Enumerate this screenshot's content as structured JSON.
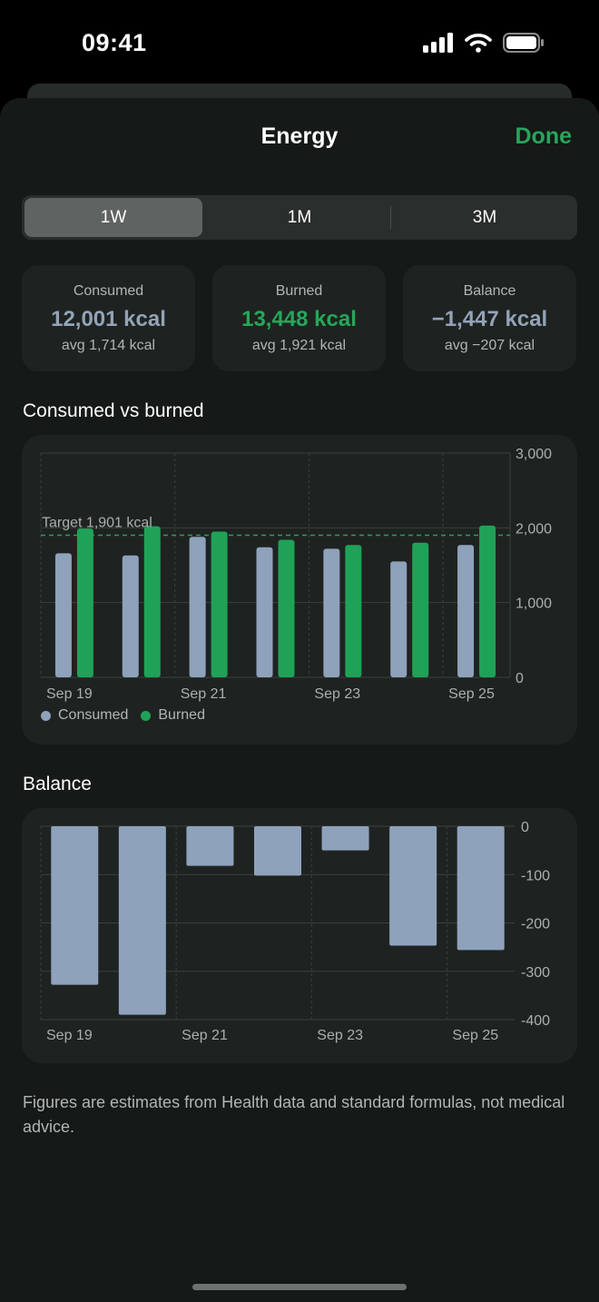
{
  "status_bar": {
    "time": "09:41",
    "icons": [
      "cellular-signal-icon",
      "wifi-icon",
      "battery-icon"
    ]
  },
  "header": {
    "title": "Energy",
    "done_label": "Done"
  },
  "segments": {
    "items": [
      "1W",
      "1M",
      "3M"
    ],
    "selected": "1W"
  },
  "stats": {
    "consumed": {
      "label": "Consumed",
      "value": "12,001 kcal",
      "avg": "avg 1,714 kcal"
    },
    "burned": {
      "label": "Burned",
      "value": "13,448 kcal",
      "avg": "avg 1,921 kcal"
    },
    "balance": {
      "label": "Balance",
      "value": "−1,447 kcal",
      "avg": "avg −207 kcal"
    }
  },
  "sections": {
    "consumed_vs_burned": "Consumed vs burned",
    "balance": "Balance"
  },
  "legend": {
    "consumed": "Consumed",
    "burned": "Burned"
  },
  "colors": {
    "consumed": "#8fa2bb",
    "burned": "#1fa257",
    "accent": "#2aa45c",
    "target_line": "#2a9d58"
  },
  "chart_data": [
    {
      "type": "bar",
      "title": "Consumed vs burned",
      "categories": [
        "Sep 19",
        "Sep 20",
        "Sep 21",
        "Sep 22",
        "Sep 23",
        "Sep 24",
        "Sep 25"
      ],
      "x_tick_labels": [
        "Sep 19",
        "Sep 21",
        "Sep 23",
        "Sep 25"
      ],
      "series": [
        {
          "name": "Consumed",
          "values": [
            1660,
            1630,
            1880,
            1740,
            1720,
            1550,
            1770
          ]
        },
        {
          "name": "Burned",
          "values": [
            1990,
            2020,
            1950,
            1840,
            1770,
            1800,
            2030
          ]
        }
      ],
      "target": {
        "label": "Target 1,901 kcal",
        "value": 1901
      },
      "ylim": [
        0,
        3000
      ],
      "y_ticks": [
        0,
        1000,
        2000,
        3000
      ],
      "y_tick_labels": [
        "0",
        "1,000",
        "2,000",
        "3,000"
      ],
      "legend": "bottom-left",
      "grid": true
    },
    {
      "type": "bar",
      "title": "Balance",
      "categories": [
        "Sep 19",
        "Sep 20",
        "Sep 21",
        "Sep 22",
        "Sep 23",
        "Sep 24",
        "Sep 25"
      ],
      "x_tick_labels": [
        "Sep 19",
        "Sep 21",
        "Sep 23",
        "Sep 25"
      ],
      "values": [
        -328,
        -390,
        -82,
        -102,
        -50,
        -247,
        -256
      ],
      "ylim": [
        -400,
        0
      ],
      "y_ticks": [
        0,
        -100,
        -200,
        -300,
        -400
      ],
      "y_tick_labels": [
        "0",
        "-100",
        "-200",
        "-300",
        "-400"
      ],
      "grid": true
    }
  ],
  "footnote": "Figures are estimates from Health data and standard formulas, not medical advice."
}
